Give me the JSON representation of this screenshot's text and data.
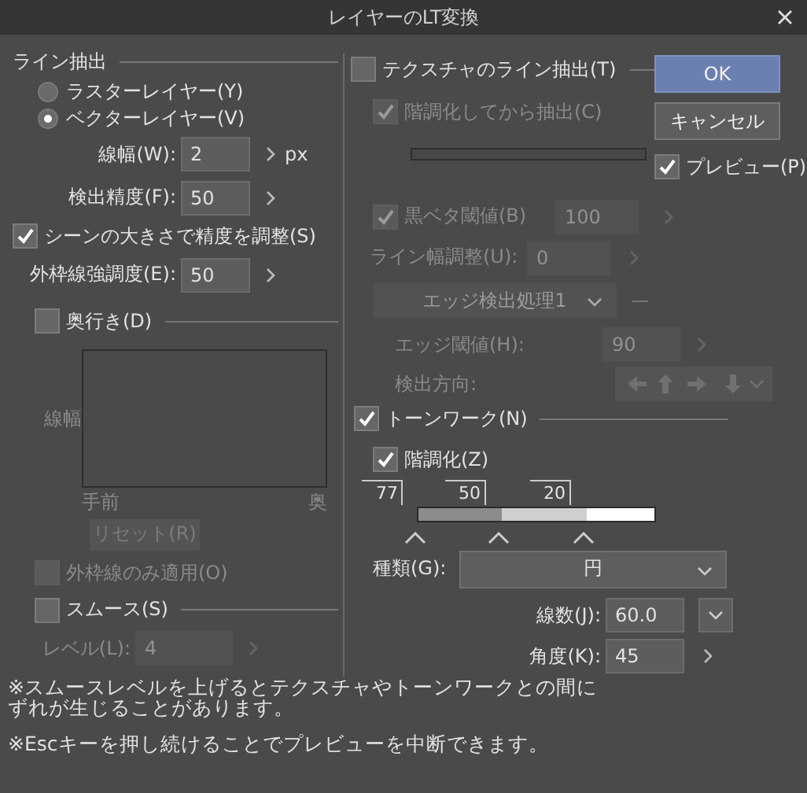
{
  "window": {
    "title": "レイヤーのLT変換"
  },
  "line_extract": {
    "title": "ライン抽出",
    "layer_options": [
      {
        "label": "ラスターレイヤー(Y)",
        "selected": false
      },
      {
        "label": "ベクターレイヤー(V)",
        "selected": true
      }
    ],
    "fields": [
      {
        "label": "線幅(W):",
        "value": "2",
        "unit": "px"
      },
      {
        "label": "検出精度(F):",
        "value": "50"
      }
    ],
    "adjust_scene": {
      "label": "シーンの大きさで精度を調整(S)",
      "checked": true
    },
    "outline_field": {
      "label": "外枠線強調度(E):",
      "value": "50"
    }
  },
  "depth": {
    "label": "奥行き(D)",
    "checked": false,
    "axis_label": "線幅",
    "near": "手前",
    "far": "奥",
    "reset": "リセット(R)",
    "outline_only": {
      "label": "外枠線のみ適用(O)",
      "checked": false
    }
  },
  "smooth": {
    "label": "スムース(S)",
    "checked": false,
    "level_label": "レベル(L):",
    "level_value": "4"
  },
  "texture": {
    "label": "テクスチャのライン抽出(T)",
    "checked": false,
    "tone_first": {
      "label": "階調化してから抽出(C)",
      "checked": true
    },
    "black_threshold": {
      "label": "黒ベタ閾値(B)",
      "checked": true,
      "value": "100"
    },
    "line_width_adjust": {
      "label": "ライン幅調整(U):",
      "value": "0"
    },
    "edge_mode": "エッジ検出処理1",
    "edge_threshold": {
      "label": "エッジ閾値(H):",
      "value": "90"
    },
    "direction_label": "検出方向:"
  },
  "tonework": {
    "label": "トーンワーク(N)",
    "checked": true,
    "gradation": {
      "label": "階調化(Z)",
      "checked": true
    },
    "stops": [
      "77",
      "50",
      "20"
    ],
    "type": {
      "label": "種類(G):",
      "value": "円"
    },
    "lines": {
      "label": "線数(J):",
      "value": "60.0"
    },
    "angle": {
      "label": "角度(K):",
      "value": "45"
    }
  },
  "buttons": [
    {
      "label": "OK",
      "primary": true
    },
    {
      "label": "キャンセル",
      "primary": false
    }
  ],
  "preview": {
    "label": "プレビュー(P)",
    "checked": true
  },
  "notes": [
    "※スムースレベルを上げるとテクスチャやトーンワークとの間にずれが生じることがあります。",
    "※Escキーを押し続けることでプレビューを中断できます。"
  ]
}
